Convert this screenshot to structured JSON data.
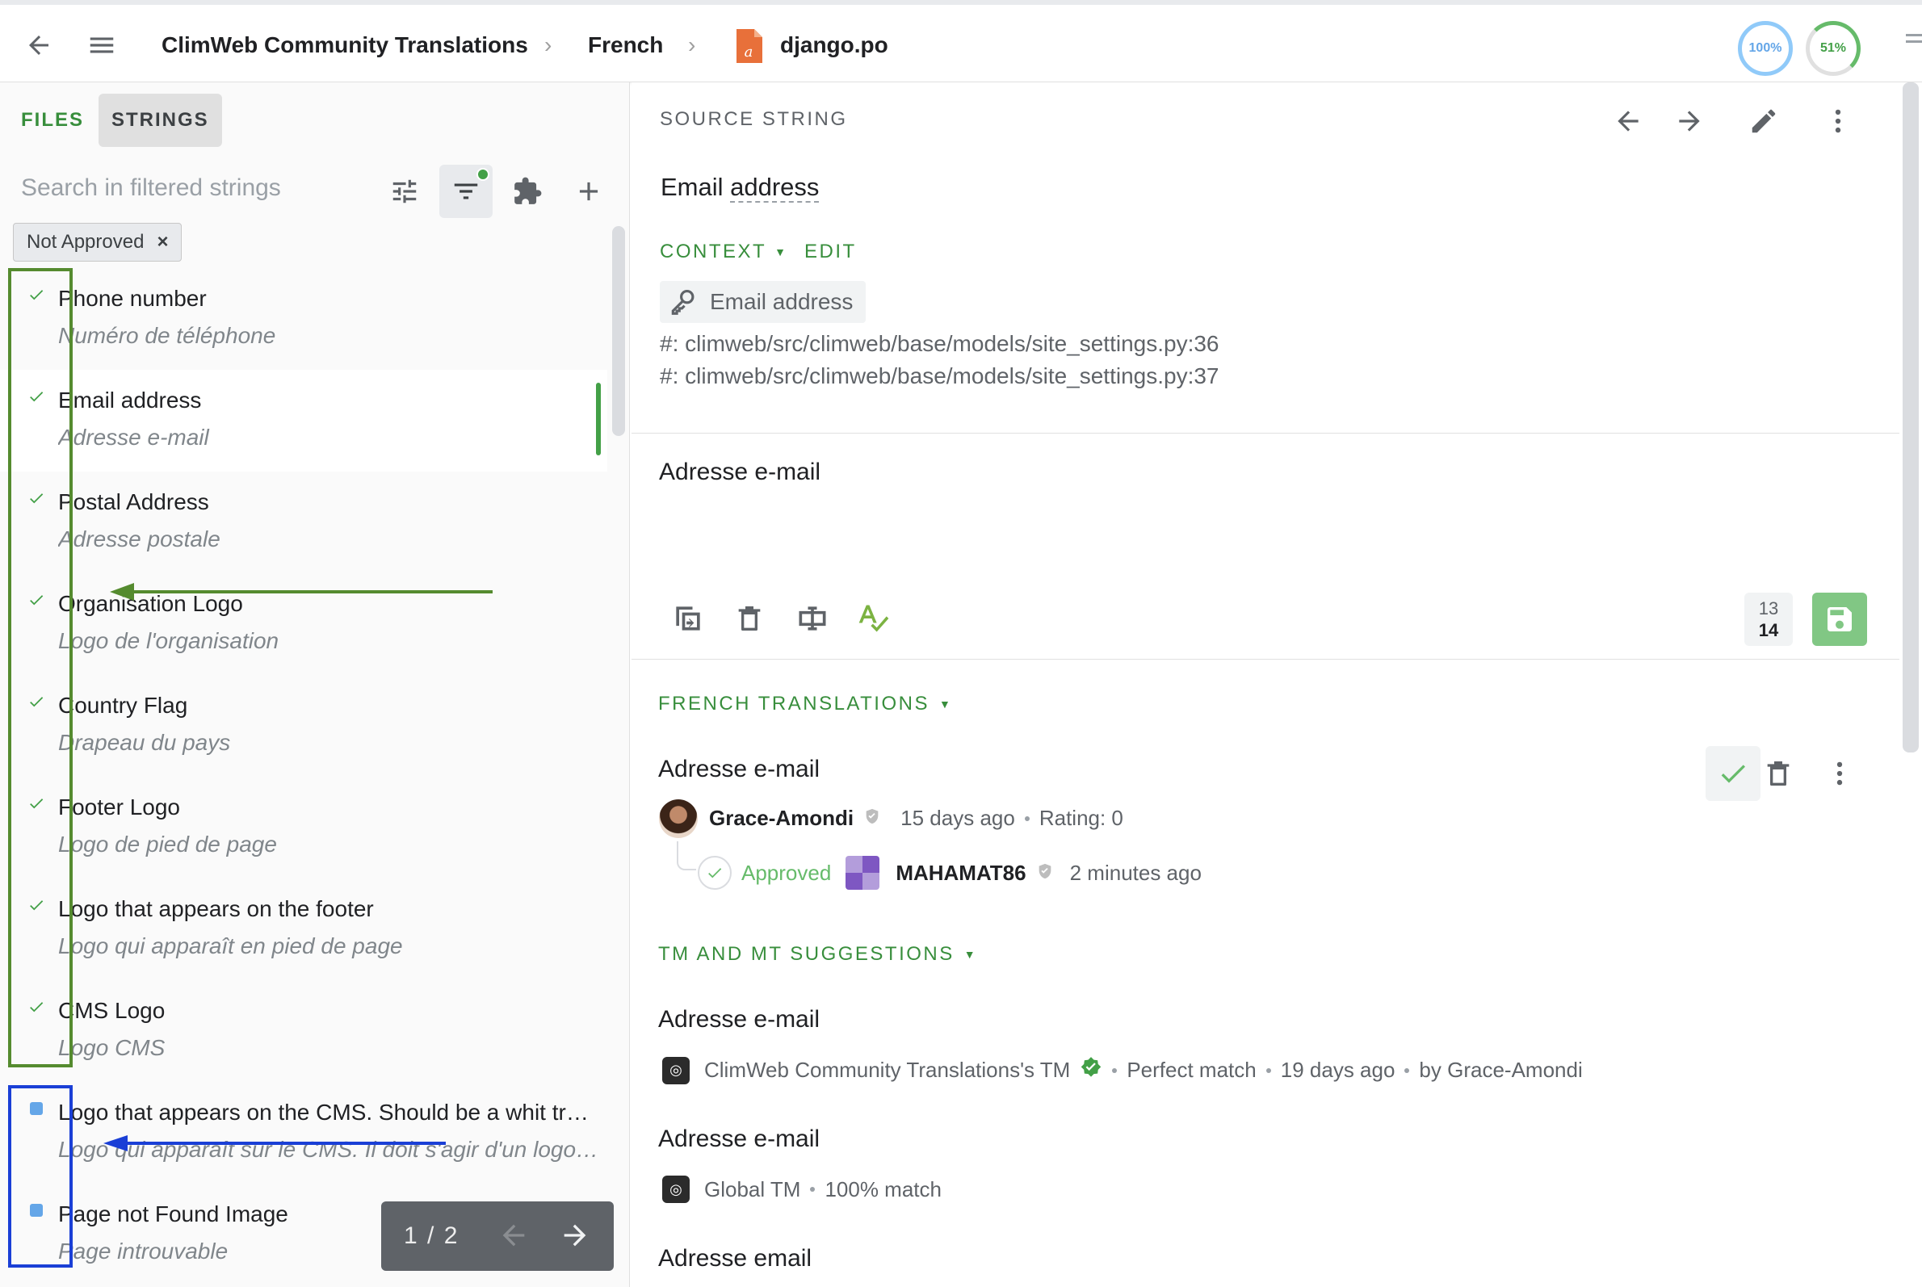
{
  "header": {
    "breadcrumb": [
      "ClimWeb Community Translations",
      "French",
      "django.po"
    ],
    "progress_translated": "100%",
    "progress_approved": "51%"
  },
  "left_panel": {
    "tabs": [
      {
        "label": "FILES"
      },
      {
        "label": "STRINGS"
      }
    ],
    "search_placeholder": "Search in filtered strings",
    "filter_chip": "Not Approved",
    "filter_chip_close": "×",
    "strings": [
      {
        "source": "Phone number",
        "translation": "Numéro de téléphone",
        "status": "approved"
      },
      {
        "source": "Email address",
        "translation": "Adresse e-mail",
        "status": "approved",
        "selected": true
      },
      {
        "source": "Postal Address",
        "translation": "Adresse postale",
        "status": "approved"
      },
      {
        "source": "Organisation Logo",
        "translation": "Logo de l'organisation",
        "status": "approved"
      },
      {
        "source": "Country Flag",
        "translation": "Drapeau du pays",
        "status": "approved"
      },
      {
        "source": "Footer Logo",
        "translation": "Logo de pied de page",
        "status": "approved"
      },
      {
        "source": "Logo that appears on the footer",
        "translation": "Logo qui apparaît en pied de page",
        "status": "approved"
      },
      {
        "source": "CMS Logo",
        "translation": "Logo CMS",
        "status": "approved"
      },
      {
        "source": "Logo that appears on the CMS. Should be a whit tra…",
        "translation": "Logo qui apparaît sur le CMS. Il doit s'agir d'un logo bl…",
        "status": "translated"
      },
      {
        "source": "Page not Found Image",
        "translation": "Page introuvable",
        "status": "translated"
      }
    ],
    "pager": {
      "label": "1 / 2"
    }
  },
  "editor": {
    "source_heading": "SOURCE STRING",
    "source_text_a": "Email ",
    "source_text_b": "address",
    "context_label": "CONTEXT",
    "edit_label": "EDIT",
    "context_key": "Email address",
    "refs": [
      "#: climweb/src/climweb/base/models/site_settings.py:36",
      "#: climweb/src/climweb/base/models/site_settings.py:37"
    ],
    "translation_value": "Adresse e-mail",
    "char_count_source": "13",
    "char_count_translation": "14"
  },
  "translations": {
    "heading": "FRENCH TRANSLATIONS",
    "item": {
      "text": "Adresse e-mail",
      "author": "Grace-Amondi",
      "time": "15 days ago",
      "rating": "Rating: 0",
      "approved_label": "Approved",
      "approver": "MAHAMAT86",
      "approved_time": "2 minutes ago"
    }
  },
  "suggestions": {
    "heading": "TM AND MT SUGGESTIONS",
    "items": [
      {
        "text": "Adresse e-mail",
        "source": "ClimWeb Community Translations's TM",
        "match": "Perfect match",
        "time": "19 days ago",
        "by": "by Grace-Amondi"
      },
      {
        "text": "Adresse e-mail",
        "source": "Global TM",
        "match": "100% match"
      },
      {
        "text": "Adresse email"
      }
    ]
  },
  "colors": {
    "accent_green": "#43a047",
    "link_green": "#388e3c",
    "annotation_green": "#558b2f",
    "annotation_blue": "#1a3fd6",
    "progress_blue": "#90caf9"
  }
}
